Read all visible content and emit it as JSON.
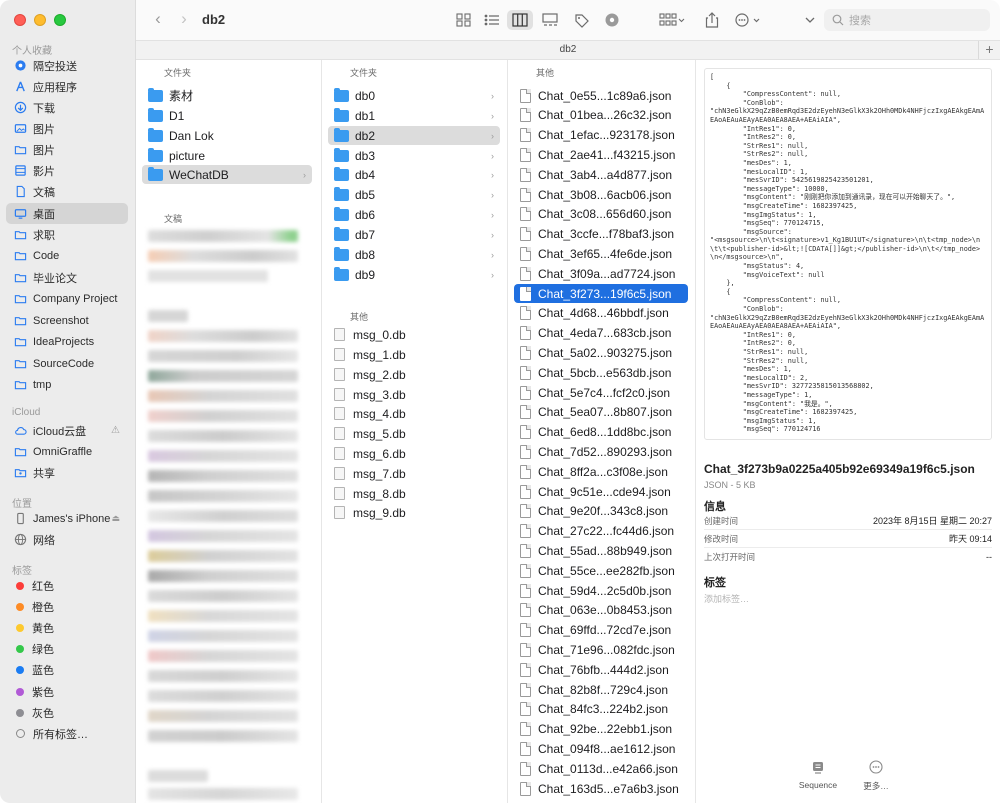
{
  "window": {
    "folder_title": "db2",
    "path_tab": "db2"
  },
  "toolbar": {
    "search_placeholder": "搜索"
  },
  "sidebar": {
    "favorites_title": "个人收藏",
    "favorites": [
      "隔空投送",
      "应用程序",
      "下载",
      "图片",
      "图片",
      "影片",
      "文稿",
      "桌面",
      "求职",
      "Code",
      "毕业论文",
      "Company Project",
      "Screenshot",
      "IdeaProjects",
      "SourceCode",
      "tmp"
    ],
    "icloud_title": "iCloud",
    "icloud": [
      "iCloud云盘",
      "OmniGraffle",
      "共享"
    ],
    "locations_title": "位置",
    "locations": [
      "James's iPhone",
      "网络"
    ],
    "tags_title": "标签",
    "tags": [
      {
        "label": "红色",
        "color": "#fc3d39"
      },
      {
        "label": "橙色",
        "color": "#fd8b25"
      },
      {
        "label": "黄色",
        "color": "#fdc92e"
      },
      {
        "label": "绿色",
        "color": "#34c84a"
      },
      {
        "label": "蓝色",
        "color": "#1b7cf2"
      },
      {
        "label": "紫色",
        "color": "#b15ad6"
      },
      {
        "label": "灰色",
        "color": "#8e8e93"
      },
      {
        "label": "所有标签…",
        "color": ""
      }
    ]
  },
  "col1": {
    "header": "文件夹",
    "folders": [
      "素材",
      "D1",
      "Dan Lok",
      "picture",
      "WeChatDB"
    ],
    "docs_header": "文稿"
  },
  "col2": {
    "header": "文件夹",
    "folders": [
      "db0",
      "db1",
      "db2",
      "db3",
      "db4",
      "db5",
      "db6",
      "db7",
      "db8",
      "db9"
    ],
    "other_header": "其他",
    "files": [
      "msg_0.db",
      "msg_1.db",
      "msg_2.db",
      "msg_3.db",
      "msg_4.db",
      "msg_5.db",
      "msg_6.db",
      "msg_7.db",
      "msg_8.db",
      "msg_9.db"
    ]
  },
  "col3": {
    "header": "其他",
    "files": [
      "Chat_0e55...1c89a6.json",
      "Chat_01bea...26c32.json",
      "Chat_1efac...923178.json",
      "Chat_2ae41...f43215.json",
      "Chat_3ab4...a4d877.json",
      "Chat_3b08...6acb06.json",
      "Chat_3c08...656d60.json",
      "Chat_3ccfe...f78baf3.json",
      "Chat_3ef65...4fe6de.json",
      "Chat_3f09a...ad7724.json",
      "Chat_3f273...19f6c5.json",
      "Chat_4d68...46bbdf.json",
      "Chat_4eda7...683cb.json",
      "Chat_5a02...903275.json",
      "Chat_5bcb...e563db.json",
      "Chat_5e7c4...fcf2c0.json",
      "Chat_5ea07...8b807.json",
      "Chat_6ed8...1dd8bc.json",
      "Chat_7d52...890293.json",
      "Chat_8ff2a...c3f08e.json",
      "Chat_9c51e...cde94.json",
      "Chat_9e20f...343c8.json",
      "Chat_27c22...fc44d6.json",
      "Chat_55ad...88b949.json",
      "Chat_55ce...ee282fb.json",
      "Chat_59d4...2c5d0b.json",
      "Chat_063e...0b8453.json",
      "Chat_69ffd...72cd7e.json",
      "Chat_71e96...082fdc.json",
      "Chat_76bfb...444d2.json",
      "Chat_82b8f...729c4.json",
      "Chat_84fc3...224b2.json",
      "Chat_92be...22ebb1.json",
      "Chat_094f8...ae1612.json",
      "Chat_0113d...e42a66.json",
      "Chat_163d5...e7a6b3.json"
    ]
  },
  "preview": {
    "json_text": "[\n    {\n        \"CompressContent\": null,\n        \"ConBlob\":\n\"chN3eGlkX29qZzB0emRqd3E2dzEyehN3eGlkX3k2OHh0MDk4NHFjczIxgAEAkgEAmAEAoAEAuAEAyAEA0AEA8AEA+AEAiAIA\",\n        \"IntRes1\": 0,\n        \"IntRes2\": 0,\n        \"StrRes1\": null,\n        \"StrRes2\": null,\n        \"mesDes\": 1,\n        \"mesLocalID\": 1,\n        \"mesSvrID\": 5425619825423501201,\n        \"messageType\": 10000,\n        \"msgContent\": \"刚刚把你添加到通讯录，现在可以开始聊天了。\",\n        \"msgCreateTime\": 1682397425,\n        \"msgImgStatus\": 1,\n        \"msgSeq\": 770124715,\n        \"msgSource\":\n\"<msgsource>\\n\\t<signature>v1_Kg1BU1UT</signature>\\n\\t<tmp_node>\\n\\t\\t<publisher-id>&lt;![CDATA[]]&gt;</publisher-id>\\n\\t</tmp_node>\\n</msgsource>\\n\",\n        \"msgStatus\": 4,\n        \"msgVoiceText\": null\n    },\n    {\n        \"CompressContent\": null,\n        \"ConBlob\":\n\"chN3eGlkX29qZzB0emRqd3E2dzEyehN3eGlkX3k2OHh0MDk4NHFjczIxgAEAkgEAmAEAoAEAuAEAyAEA0AEA8AEA+AEAiAIA\",\n        \"IntRes1\": 0,\n        \"IntRes2\": 0,\n        \"StrRes1\": null,\n        \"StrRes2\": null,\n        \"mesDes\": 1,\n        \"mesLocalID\": 2,\n        \"mesSvrID\": 3277235815013568802,\n        \"messageType\": 1,\n        \"msgContent\": \"我是。\",\n        \"msgCreateTime\": 1682397425,\n        \"msgImgStatus\": 1,\n        \"msgSeq\": 770124716",
    "file_name": "Chat_3f273b9a0225a405b92e69349a19f6c5.json",
    "kind": "JSON - 5 KB",
    "info_title": "信息",
    "created_label": "创建时间",
    "created_value": "2023年 8月15日 星期二 20:27",
    "modified_label": "修改时间",
    "modified_value": "昨天 09:14",
    "opened_label": "上次打开时间",
    "opened_value": "--",
    "tags_title": "标签",
    "tags_placeholder": "添加标签…",
    "action_sequence": "Sequence",
    "action_more": "更多…"
  },
  "colors": {
    "accent": "#1f6fe0",
    "folder": "#3a9bf0",
    "sidebar_bg": "#ececec"
  }
}
